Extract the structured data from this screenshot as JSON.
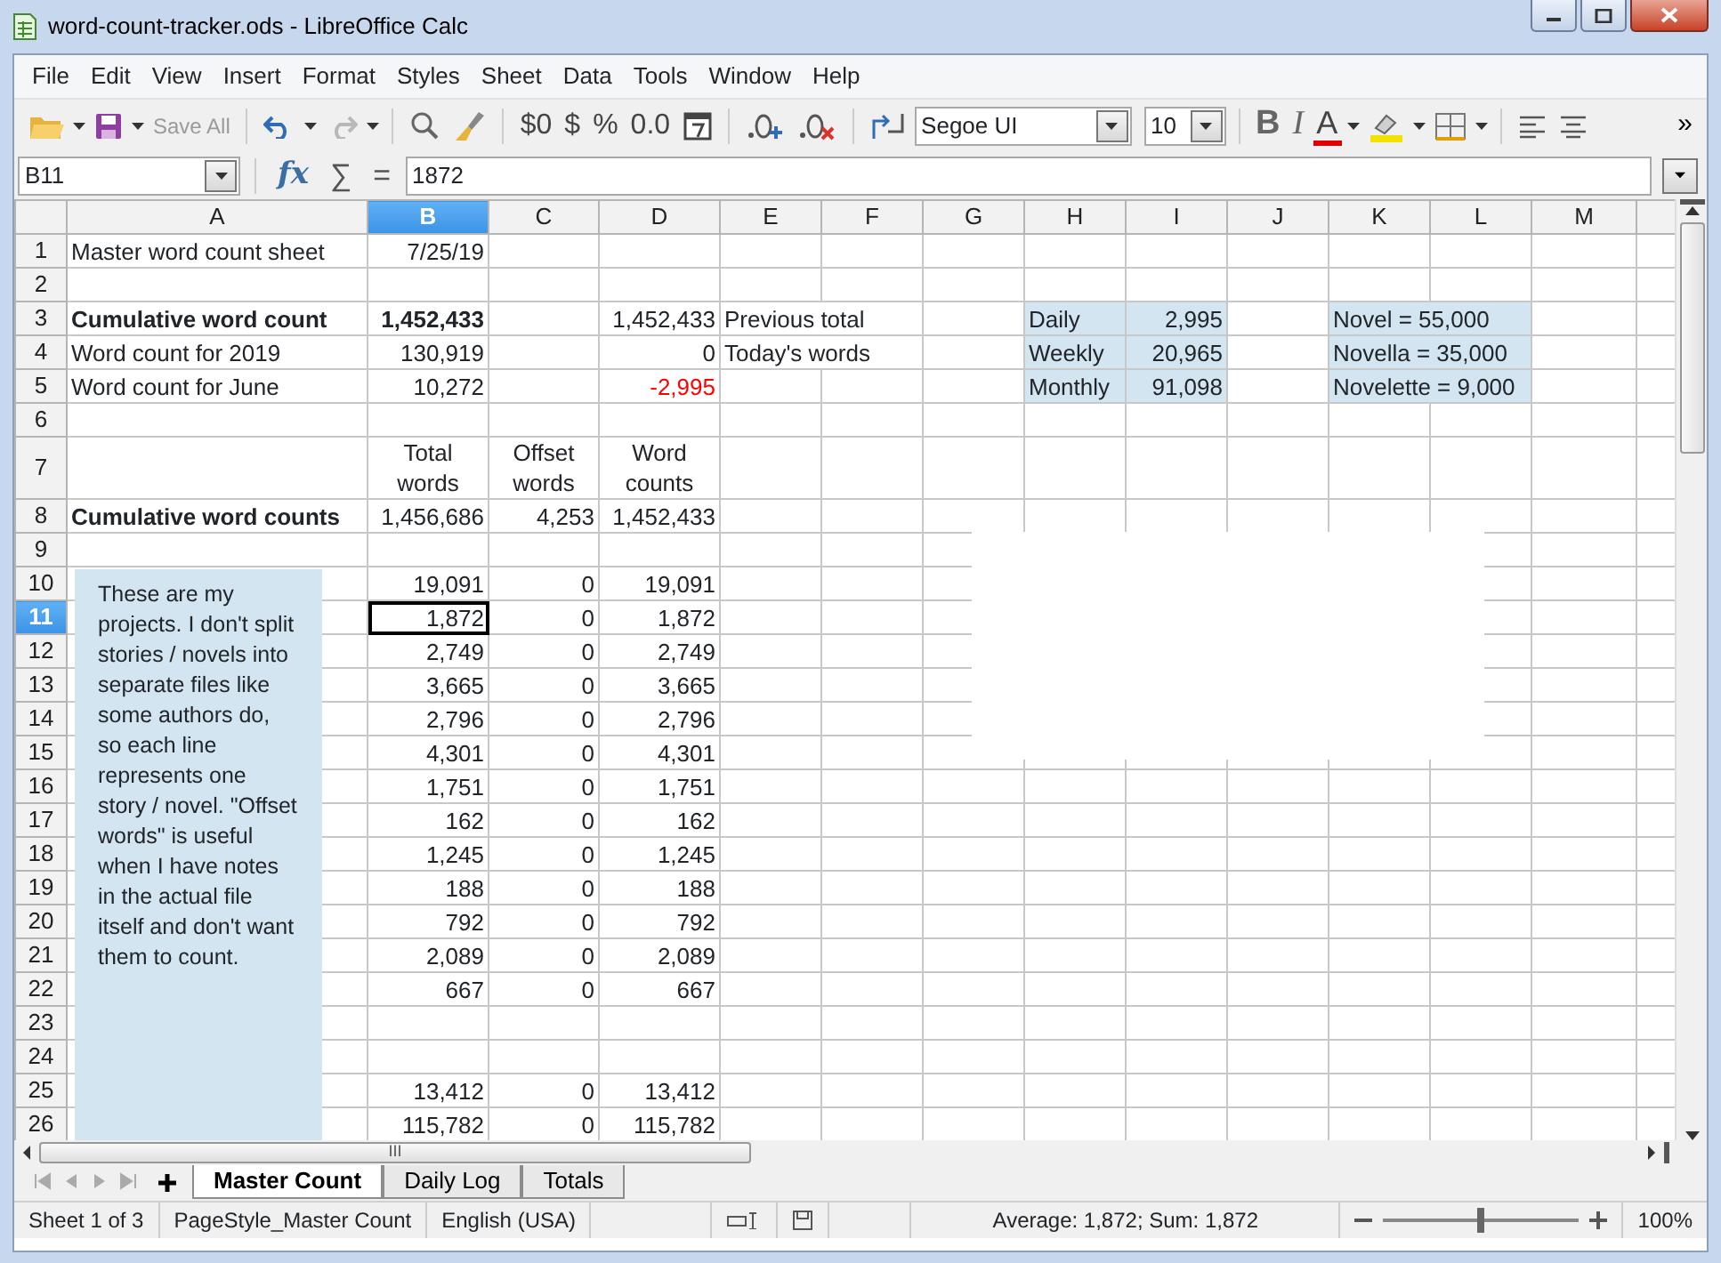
{
  "window": {
    "title": "word-count-tracker.ods - LibreOffice Calc"
  },
  "menu": [
    "File",
    "Edit",
    "View",
    "Insert",
    "Format",
    "Styles",
    "Sheet",
    "Data",
    "Tools",
    "Window",
    "Help"
  ],
  "toolbar": {
    "save_all": {
      "label": "Save All",
      "disabled": true
    },
    "redo_disabled": true,
    "format_glyphs": [
      "$0",
      "$",
      "%",
      "0.0"
    ],
    "font_name": "Segoe UI",
    "font_size": "10",
    "bold": "B",
    "italic": "I",
    "font_color": "A",
    "overflow": "»"
  },
  "formula_bar": {
    "cell_reference": "B11",
    "glyphs": [
      "fx",
      "∑",
      "="
    ],
    "content": "1872"
  },
  "columns": [
    {
      "label": "A",
      "selected": false
    },
    {
      "label": "B",
      "selected": true
    },
    {
      "label": "C",
      "selected": false
    },
    {
      "label": "D",
      "selected": false
    },
    {
      "label": "E",
      "selected": false
    },
    {
      "label": "F",
      "selected": false
    },
    {
      "label": "G",
      "selected": false
    },
    {
      "label": "H",
      "selected": false
    },
    {
      "label": "I",
      "selected": false
    },
    {
      "label": "J",
      "selected": false
    },
    {
      "label": "K",
      "selected": false
    },
    {
      "label": "L",
      "selected": false
    },
    {
      "label": "M",
      "selected": false
    }
  ],
  "rows": [
    {
      "number": "1",
      "selected": false,
      "cells": {
        "A": {
          "text": "Master word count sheet",
          "kind": "text"
        },
        "B": {
          "text": "7/25/19",
          "kind": "number"
        }
      }
    },
    {
      "number": "2",
      "selected": false,
      "cells": {}
    },
    {
      "number": "3",
      "selected": false,
      "cells": {
        "A": {
          "text": "Cumulative word count",
          "kind": "text",
          "bold": true
        },
        "B": {
          "text": "1,452,433",
          "kind": "number",
          "bold": true
        },
        "D": {
          "text": "1,452,433",
          "kind": "number"
        },
        "E": {
          "text": "Previous total",
          "kind": "text"
        },
        "H": {
          "text": "Daily",
          "kind": "text",
          "shaded": true
        },
        "I": {
          "text": "2,995",
          "kind": "number",
          "shaded": true
        },
        "K": {
          "text": "Novel = 55,000",
          "kind": "text",
          "shaded": true
        }
      }
    },
    {
      "number": "4",
      "selected": false,
      "cells": {
        "A": {
          "text": "Word count for 2019",
          "kind": "text"
        },
        "B": {
          "text": "130,919",
          "kind": "number"
        },
        "D": {
          "text": "0",
          "kind": "number"
        },
        "E": {
          "text": "Today's words",
          "kind": "text"
        },
        "H": {
          "text": "Weekly",
          "kind": "text",
          "shaded": true
        },
        "I": {
          "text": "20,965",
          "kind": "number",
          "shaded": true
        },
        "K": {
          "text": "Novella = 35,000",
          "kind": "text",
          "shaded": true
        }
      }
    },
    {
      "number": "5",
      "selected": false,
      "cells": {
        "A": {
          "text": "Word count for June",
          "kind": "text"
        },
        "B": {
          "text": "10,272",
          "kind": "number"
        },
        "D": {
          "text": "-2,995",
          "kind": "number",
          "negative": true
        },
        "H": {
          "text": "Monthly",
          "kind": "text",
          "shaded": true
        },
        "I": {
          "text": "91,098",
          "kind": "number",
          "shaded": true
        },
        "K": {
          "text": "Novelette = 9,000",
          "kind": "text",
          "shaded": true
        }
      }
    },
    {
      "number": "6",
      "selected": false,
      "cells": {}
    },
    {
      "number": "7",
      "selected": false,
      "cells": {
        "B": {
          "text": "Total words",
          "kind": "heading"
        },
        "C": {
          "text": "Offset words",
          "kind": "heading"
        },
        "D": {
          "text": "Word counts",
          "kind": "heading"
        }
      }
    },
    {
      "number": "8",
      "selected": false,
      "cells": {
        "A": {
          "text": "Cumulative word counts",
          "kind": "text",
          "bold": true
        },
        "B": {
          "text": "1,456,686",
          "kind": "number"
        },
        "C": {
          "text": "4,253",
          "kind": "number"
        },
        "D": {
          "text": "1,452,433",
          "kind": "number"
        }
      }
    },
    {
      "number": "9",
      "selected": false,
      "cells": {}
    },
    {
      "number": "10",
      "selected": false,
      "cells": {
        "B": {
          "text": "19,091",
          "kind": "number"
        },
        "C": {
          "text": "0",
          "kind": "number"
        },
        "D": {
          "text": "19,091",
          "kind": "number"
        }
      }
    },
    {
      "number": "11",
      "selected": true,
      "cells": {
        "B": {
          "text": "1,872",
          "kind": "number",
          "selected": true
        },
        "C": {
          "text": "0",
          "kind": "number"
        },
        "D": {
          "text": "1,872",
          "kind": "number"
        }
      }
    },
    {
      "number": "12",
      "selected": false,
      "cells": {
        "B": {
          "text": "2,749",
          "kind": "number"
        },
        "C": {
          "text": "0",
          "kind": "number"
        },
        "D": {
          "text": "2,749",
          "kind": "number"
        }
      }
    },
    {
      "number": "13",
      "selected": false,
      "cells": {
        "B": {
          "text": "3,665",
          "kind": "number"
        },
        "C": {
          "text": "0",
          "kind": "number"
        },
        "D": {
          "text": "3,665",
          "kind": "number"
        }
      }
    },
    {
      "number": "14",
      "selected": false,
      "cells": {
        "B": {
          "text": "2,796",
          "kind": "number"
        },
        "C": {
          "text": "0",
          "kind": "number"
        },
        "D": {
          "text": "2,796",
          "kind": "number"
        }
      }
    },
    {
      "number": "15",
      "selected": false,
      "cells": {
        "B": {
          "text": "4,301",
          "kind": "number"
        },
        "C": {
          "text": "0",
          "kind": "number"
        },
        "D": {
          "text": "4,301",
          "kind": "number"
        }
      }
    },
    {
      "number": "16",
      "selected": false,
      "cells": {
        "B": {
          "text": "1,751",
          "kind": "number"
        },
        "C": {
          "text": "0",
          "kind": "number"
        },
        "D": {
          "text": "1,751",
          "kind": "number"
        }
      }
    },
    {
      "number": "17",
      "selected": false,
      "cells": {
        "B": {
          "text": "162",
          "kind": "number"
        },
        "C": {
          "text": "0",
          "kind": "number"
        },
        "D": {
          "text": "162",
          "kind": "number"
        }
      }
    },
    {
      "number": "18",
      "selected": false,
      "cells": {
        "B": {
          "text": "1,245",
          "kind": "number"
        },
        "C": {
          "text": "0",
          "kind": "number"
        },
        "D": {
          "text": "1,245",
          "kind": "number"
        }
      }
    },
    {
      "number": "19",
      "selected": false,
      "cells": {
        "B": {
          "text": "188",
          "kind": "number"
        },
        "C": {
          "text": "0",
          "kind": "number"
        },
        "D": {
          "text": "188",
          "kind": "number"
        }
      }
    },
    {
      "number": "20",
      "selected": false,
      "cells": {
        "B": {
          "text": "792",
          "kind": "number"
        },
        "C": {
          "text": "0",
          "kind": "number"
        },
        "D": {
          "text": "792",
          "kind": "number"
        }
      }
    },
    {
      "number": "21",
      "selected": false,
      "cells": {
        "B": {
          "text": "2,089",
          "kind": "number"
        },
        "C": {
          "text": "0",
          "kind": "number"
        },
        "D": {
          "text": "2,089",
          "kind": "number"
        }
      }
    },
    {
      "number": "22",
      "selected": false,
      "cells": {
        "B": {
          "text": "667",
          "kind": "number"
        },
        "C": {
          "text": "0",
          "kind": "number"
        },
        "D": {
          "text": "667",
          "kind": "number"
        }
      }
    },
    {
      "number": "23",
      "selected": false,
      "cells": {}
    },
    {
      "number": "24",
      "selected": false,
      "cells": {}
    },
    {
      "number": "25",
      "selected": false,
      "cells": {
        "B": {
          "text": "13,412",
          "kind": "number"
        },
        "C": {
          "text": "0",
          "kind": "number"
        },
        "D": {
          "text": "13,412",
          "kind": "number"
        }
      }
    },
    {
      "number": "26",
      "selected": false,
      "cells": {
        "B": {
          "text": "115,782",
          "kind": "number"
        },
        "C": {
          "text": "0",
          "kind": "number"
        },
        "D": {
          "text": "115,782",
          "kind": "number"
        }
      }
    }
  ],
  "note_box": {
    "text": "These are my projects. I don't split stories / novels into separate files like some authors do, so each line represents one story / novel. \"Offset words\" is useful when I have notes in the actual file itself and don't want them to count."
  },
  "sheet_tabs": [
    {
      "label": "Master Count",
      "selected": true
    },
    {
      "label": "Daily Log",
      "selected": false
    },
    {
      "label": "Totals",
      "selected": false
    }
  ],
  "scroll_grip": "III",
  "status_bar": {
    "sheet": "Sheet 1 of 3",
    "page_style": "PageStyle_Master Count",
    "language": "English (USA)",
    "selection_summary": "Average: 1,872; Sum: 1,872",
    "zoom": {
      "level": 0.5,
      "reading": "100%"
    }
  }
}
